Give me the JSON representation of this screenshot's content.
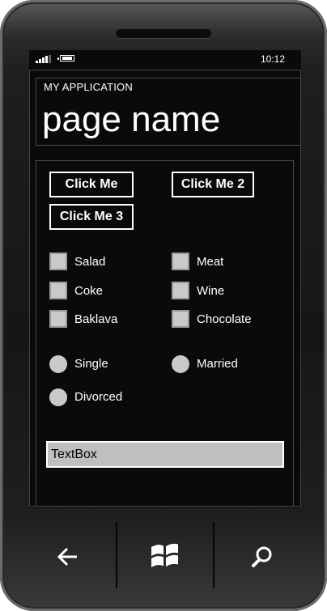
{
  "status_bar": {
    "time": "10:12"
  },
  "header": {
    "app_title": "MY APPLICATION",
    "page_title": "page name"
  },
  "buttons": {
    "click_me": "Click Me",
    "click_me_2": "Click Me 2",
    "click_me_3": "Click Me 3"
  },
  "checkboxes": [
    {
      "label": "Salad",
      "checked": false
    },
    {
      "label": "Meat",
      "checked": false
    },
    {
      "label": "Coke",
      "checked": false
    },
    {
      "label": "Wine",
      "checked": false
    },
    {
      "label": "Baklava",
      "checked": false
    },
    {
      "label": "Chocolate",
      "checked": false
    }
  ],
  "radios": [
    {
      "label": "Single",
      "selected": false
    },
    {
      "label": "Married",
      "selected": false
    },
    {
      "label": "Divorced",
      "selected": false
    }
  ],
  "textbox": {
    "value": "TextBox"
  },
  "hardware_keys": {
    "back": "back-arrow-icon",
    "start": "windows-logo-icon",
    "search": "search-icon"
  },
  "colors": {
    "background": "#0a0a0a",
    "foreground": "#ffffff",
    "control_fill": "#c9c9c9"
  }
}
